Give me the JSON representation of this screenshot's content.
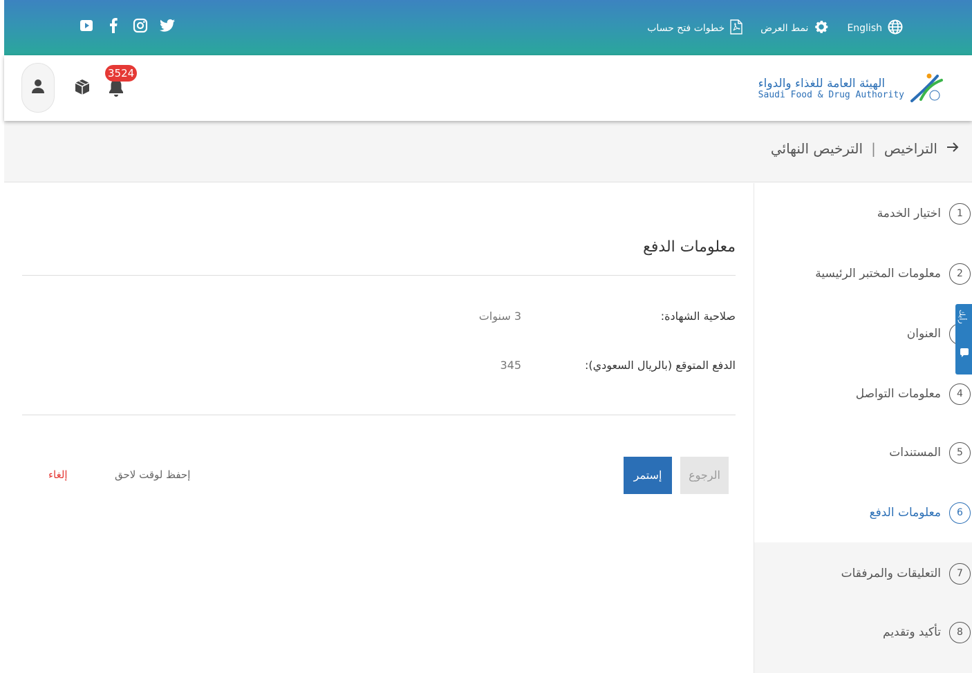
{
  "topbar": {
    "language_label": "English",
    "display_mode_label": "نمط العرض",
    "account_steps_label": "خطوات فتح حساب",
    "social": [
      "youtube-icon",
      "facebook-icon",
      "instagram-icon",
      "twitter-icon"
    ]
  },
  "header": {
    "logo_ar": "الهيئة العامة للغذاء والدواء",
    "logo_en": "Saudi Food & Drug Authority",
    "notification_count": "3524"
  },
  "breadcrumb": {
    "items": [
      "التراخيص",
      "الترخيص النهائي"
    ],
    "separator": "|"
  },
  "steps": [
    {
      "num": "1",
      "label": "اختيار الخدمة"
    },
    {
      "num": "2",
      "label": "معلومات المختبر الرئيسية"
    },
    {
      "num": "3",
      "label": "العنوان"
    },
    {
      "num": "4",
      "label": "معلومات التواصل"
    },
    {
      "num": "5",
      "label": "المستندات"
    },
    {
      "num": "6",
      "label": "معلومات الدفع"
    },
    {
      "num": "7",
      "label": "التعليقات والمرفقات"
    },
    {
      "num": "8",
      "label": "تأكيد وتقديم"
    }
  ],
  "feedback": {
    "label": "رأيك"
  },
  "main": {
    "section_title": "معلومات الدفع",
    "fields": [
      {
        "label": "صلاحية الشهادة:",
        "value": "3 سنوات"
      },
      {
        "label": "الدفع المتوقع (بالريال السعودي):",
        "value": "345"
      }
    ],
    "back_label": "الرجوع",
    "continue_label": "إستمر",
    "save_later_label": "إحفظ لوقت لاحق",
    "cancel_label": "إلغاء"
  },
  "colors": {
    "primary": "#2b6fb6",
    "danger": "#e53935",
    "topbar_start": "#3c83c0",
    "topbar_end": "#2aa79b"
  }
}
